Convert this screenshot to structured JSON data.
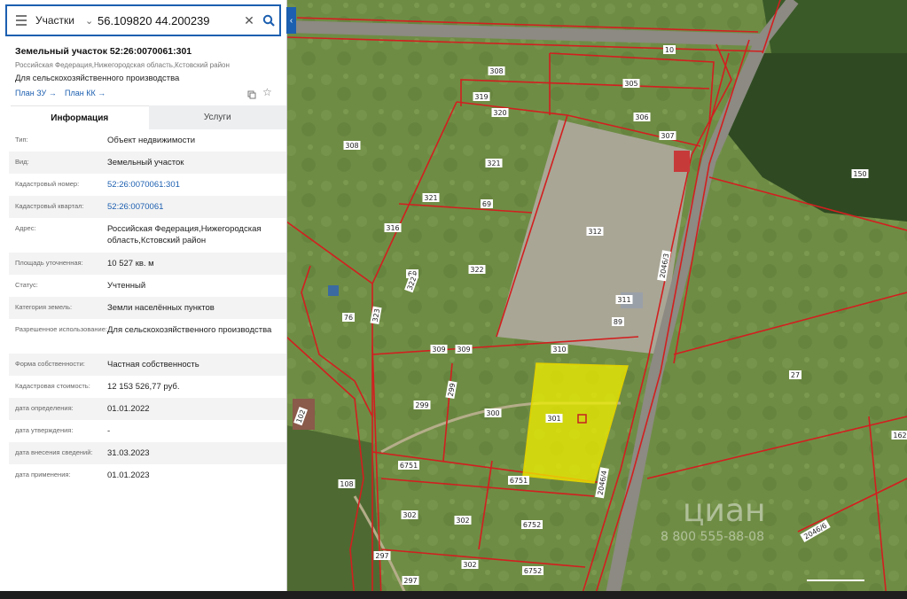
{
  "search": {
    "category": "Участки",
    "query": "56.109820 44.200239"
  },
  "parcel": {
    "title": "Земельный участок 52:26:0070061:301",
    "address": "Российская Федерация,Нижегородская область,Кстовский район",
    "purpose": "Для сельскохозяйственного производства",
    "link_zu": "План ЗУ →",
    "link_kk": "План КК →"
  },
  "tabs": [
    "Информация",
    "Услуги"
  ],
  "rows": [
    {
      "label": "Тип:",
      "value": "Объект недвижимости"
    },
    {
      "label": "Вид:",
      "value": "Земельный участок"
    },
    {
      "label": "Кадастровый номер:",
      "value": "52:26:0070061:301"
    },
    {
      "label": "Кадастровый квартал:",
      "value": "52:26:0070061"
    },
    {
      "label": "Адрес:",
      "value": "Российская Федерация,Нижегородская область,Кстовский район"
    },
    {
      "label": "Площадь уточненная:",
      "value": "10 527 кв. м"
    },
    {
      "label": "Статус:",
      "value": "Учтенный"
    },
    {
      "label": "Категория земель:",
      "value": "Земли населённых пунктов"
    },
    {
      "label": "Разрешенное использование:",
      "value": "Для сельскохозяйственного производства"
    },
    {
      "label": "Форма собственности:",
      "value": "Частная собственность"
    },
    {
      "label": "Кадастровая стоимость:",
      "value": "12 153 526,77 руб."
    },
    {
      "label": "дата определения:",
      "value": "01.01.2022"
    },
    {
      "label": "дата утверждения:",
      "value": "-"
    },
    {
      "label": "дата внесения сведений:",
      "value": "31.03.2023"
    },
    {
      "label": "дата применения:",
      "value": "01.01.2023"
    }
  ],
  "map_labels": [
    "308",
    "305",
    "10",
    "319",
    "320",
    "306",
    "307",
    "308",
    "321",
    "150",
    "321",
    "69",
    "312",
    "316",
    "69",
    "322",
    "322",
    "311",
    "76",
    "323",
    "89",
    "309",
    "309",
    "310",
    "27",
    "299",
    "301",
    "300",
    "102",
    "6751",
    "6751",
    "108",
    "302",
    "302",
    "6752",
    "6752",
    "297",
    "302",
    "297",
    "2046/4",
    "2046/3",
    "162",
    "2046/6",
    "299"
  ],
  "watermark": "циан",
  "watermark_phone": "8 800 555-88-08",
  "colors": {
    "accent": "#1c5fb0",
    "parcel_highlight": "#f0f000",
    "boundary": "#d21f1f"
  }
}
